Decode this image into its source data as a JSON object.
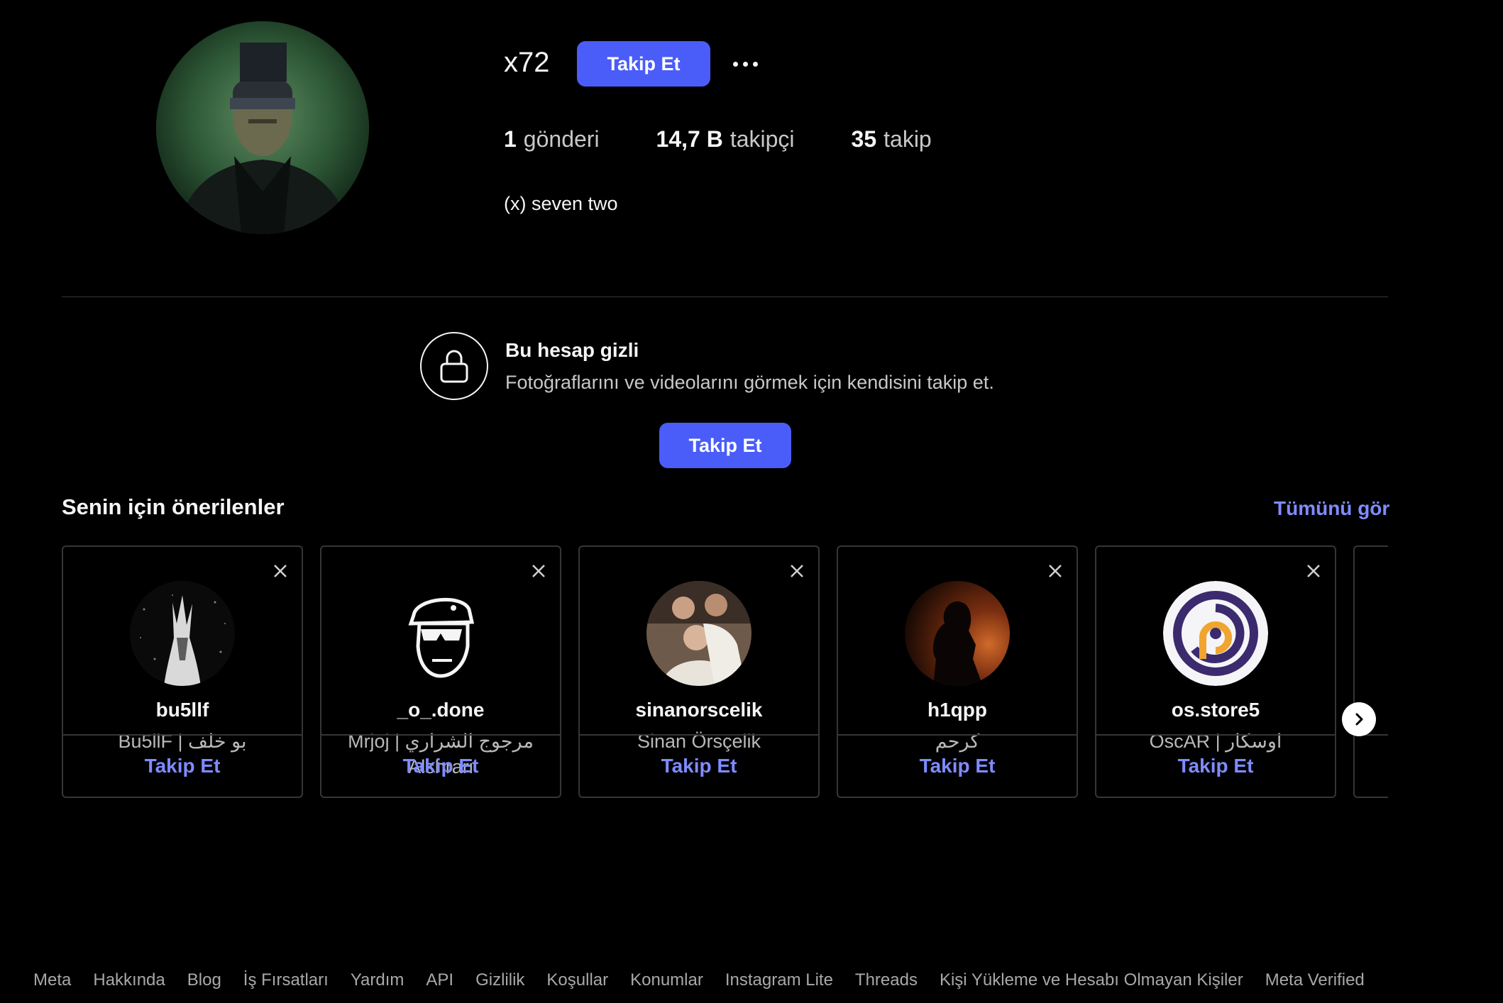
{
  "profile": {
    "username": "x72",
    "follow_label": "Takip Et",
    "stats": [
      {
        "count": "1",
        "label": "gönderi"
      },
      {
        "count": "14,7 B",
        "label": "takipçi"
      },
      {
        "count": "35",
        "label": "takip"
      }
    ],
    "bio": "(x) seven two"
  },
  "private_notice": {
    "title": "Bu hesap gizli",
    "description": "Fotoğraflarını ve videolarını görmek için kendisini takip et.",
    "follow_label": "Takip Et"
  },
  "suggestions": {
    "title": "Senin için önerilenler",
    "see_all": "Tümünü gör",
    "cards": [
      {
        "username": "bu5llf",
        "name": "Bu5llF | بو خلف",
        "follow": "Takip Et",
        "avatar": "spirit-illustration"
      },
      {
        "username": "_o_.done",
        "name": "Mrjoj | مرجوج الشراري Alshrari",
        "follow": "Takip Et",
        "avatar": "soldier-logo"
      },
      {
        "username": "sinanorscelik",
        "name": "Sinan Örsçelik",
        "follow": "Takip Et",
        "avatar": "group-photo"
      },
      {
        "username": "h1qpp",
        "name": "كرحم",
        "follow": "Takip Et",
        "avatar": "silhouette-photo"
      },
      {
        "username": "os.store5",
        "name": "OscAR | اوسكار",
        "follow": "Takip Et",
        "avatar": "brand-logo"
      }
    ]
  },
  "footer": {
    "links": [
      "Meta",
      "Hakkında",
      "Blog",
      "İş Fırsatları",
      "Yardım",
      "API",
      "Gizlilik",
      "Koşullar",
      "Konumlar",
      "Instagram Lite",
      "Threads",
      "Kişi Yükleme ve Hesabı Olmayan Kişiler",
      "Meta Verified"
    ]
  },
  "colors": {
    "accent": "#4a5df9",
    "link": "#7e8cff",
    "background": "#000000",
    "border": "#363636"
  }
}
